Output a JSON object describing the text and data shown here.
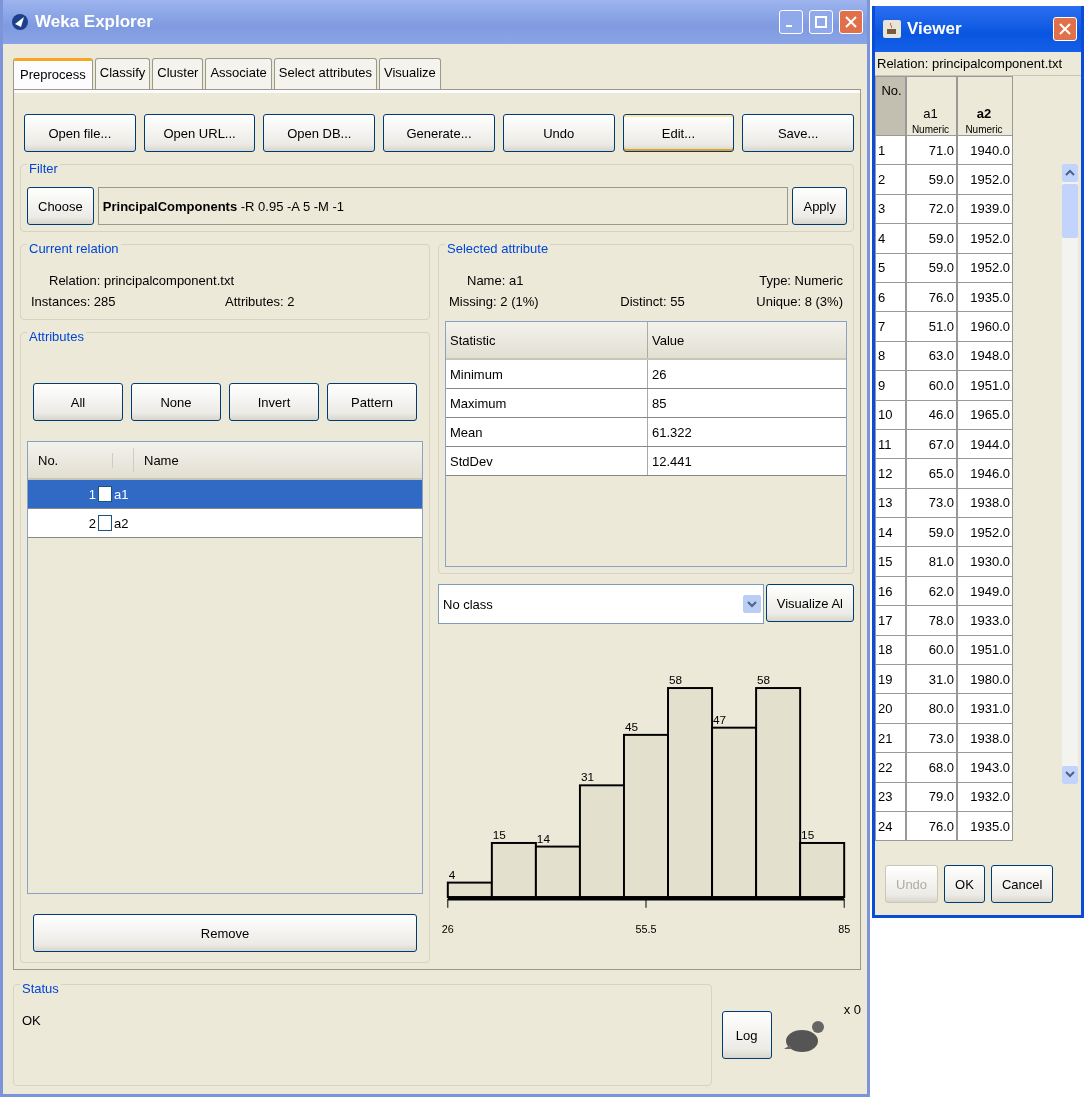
{
  "explorer": {
    "title": "Weka Explorer",
    "tabs": [
      {
        "label": "Preprocess",
        "selected": true
      },
      {
        "label": "Classify",
        "selected": false
      },
      {
        "label": "Cluster",
        "selected": false
      },
      {
        "label": "Associate",
        "selected": false
      },
      {
        "label": "Select attributes",
        "selected": false
      },
      {
        "label": "Visualize",
        "selected": false
      }
    ],
    "toolbar": [
      {
        "label": "Open file...",
        "focused": false
      },
      {
        "label": "Open URL...",
        "focused": false
      },
      {
        "label": "Open DB...",
        "focused": false
      },
      {
        "label": "Generate...",
        "focused": false
      },
      {
        "label": "Undo",
        "focused": false
      },
      {
        "label": "Edit...",
        "focused": true
      },
      {
        "label": "Save...",
        "focused": false
      }
    ],
    "filter": {
      "title": "Filter",
      "choose": "Choose",
      "spec": "**PrincipalComponents** -R 0.95 -A 5 -M -1",
      "apply": "Apply"
    },
    "current_relation": {
      "title": "Current relation",
      "relation": "Relation: principalcomponent.txt",
      "instances": "Instances: 285",
      "attributes": "Attributes: 2"
    },
    "attributes": {
      "title": "Attributes",
      "buttons": [
        "All",
        "None",
        "Invert",
        "Pattern"
      ],
      "columns": [
        "No.",
        "Name"
      ],
      "rows": [
        {
          "no": "1",
          "name": "a1",
          "checked": false,
          "selected": true
        },
        {
          "no": "2",
          "name": "a2",
          "checked": false,
          "selected": false
        }
      ],
      "remove": "Remove"
    },
    "selected_attribute": {
      "title": "Selected attribute",
      "name": "Name: a1",
      "type": "Type: Numeric",
      "missing": "Missing: 2 (1%)",
      "distinct": "Distinct: 55",
      "unique": "Unique: 8 (3%)",
      "columns": [
        "Statistic",
        "Value"
      ],
      "rows": [
        [
          "Minimum",
          "26"
        ],
        [
          "Maximum",
          "85"
        ],
        [
          "Mean",
          "61.322"
        ],
        [
          "StdDev",
          "12.441"
        ]
      ]
    },
    "class_select": {
      "value": "No class"
    },
    "visualize_all": "Visualize Al",
    "histogram": {
      "bar_labels": [
        "4",
        "15",
        "14",
        "31",
        "45",
        "58",
        "47",
        "58",
        "15"
      ],
      "axis_labels": [
        "26",
        "55.5",
        "85"
      ]
    },
    "status": {
      "title": "Status",
      "message": "OK",
      "log": "Log",
      "count": "x 0"
    }
  },
  "viewer": {
    "title": "Viewer",
    "relation": "Relation: principalcomponent.txt",
    "columns": [
      {
        "name": "No.",
        "selected": false
      },
      {
        "name": "a1",
        "type": "Numeric",
        "selected": false
      },
      {
        "name": "a2",
        "type": "Numeric",
        "selected": true
      }
    ],
    "rows": [
      [
        "1",
        "71.0",
        "1940.0"
      ],
      [
        "2",
        "59.0",
        "1952.0"
      ],
      [
        "3",
        "72.0",
        "1939.0"
      ],
      [
        "4",
        "59.0",
        "1952.0"
      ],
      [
        "5",
        "59.0",
        "1952.0"
      ],
      [
        "6",
        "76.0",
        "1935.0"
      ],
      [
        "7",
        "51.0",
        "1960.0"
      ],
      [
        "8",
        "63.0",
        "1948.0"
      ],
      [
        "9",
        "60.0",
        "1951.0"
      ],
      [
        "10",
        "46.0",
        "1965.0"
      ],
      [
        "11",
        "67.0",
        "1944.0"
      ],
      [
        "12",
        "65.0",
        "1946.0"
      ],
      [
        "13",
        "73.0",
        "1938.0"
      ],
      [
        "14",
        "59.0",
        "1952.0"
      ],
      [
        "15",
        "81.0",
        "1930.0"
      ],
      [
        "16",
        "62.0",
        "1949.0"
      ],
      [
        "17",
        "78.0",
        "1933.0"
      ],
      [
        "18",
        "60.0",
        "1951.0"
      ],
      [
        "19",
        "31.0",
        "1980.0"
      ],
      [
        "20",
        "80.0",
        "1931.0"
      ],
      [
        "21",
        "73.0",
        "1938.0"
      ],
      [
        "22",
        "68.0",
        "1943.0"
      ],
      [
        "23",
        "79.0",
        "1932.0"
      ],
      [
        "24",
        "76.0",
        "1935.0"
      ]
    ],
    "buttons": [
      {
        "label": "Undo",
        "disabled": true
      },
      {
        "label": "OK",
        "disabled": false
      },
      {
        "label": "Cancel",
        "disabled": false
      }
    ]
  }
}
